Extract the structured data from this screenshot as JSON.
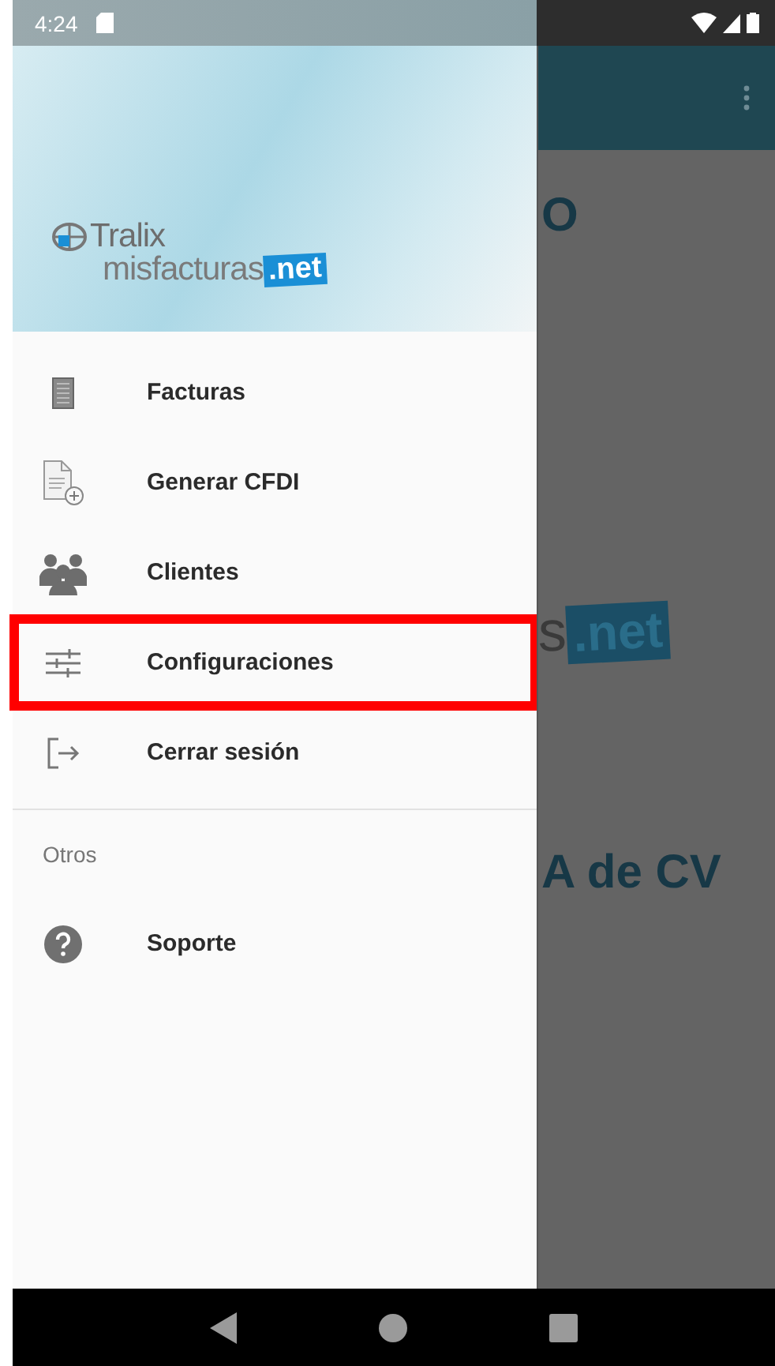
{
  "status_bar": {
    "time": "4:24"
  },
  "drawer": {
    "logo": {
      "brand": "Tralix",
      "product": "misfacturas",
      "badge": ".net"
    },
    "items": [
      {
        "kind": "invoices",
        "label": "Facturas",
        "highlighted": false
      },
      {
        "kind": "generate",
        "label": "Generar CFDI",
        "highlighted": false
      },
      {
        "kind": "clients",
        "label": "Clientes",
        "highlighted": false
      },
      {
        "kind": "settings",
        "label": "Configuraciones",
        "highlighted": true
      },
      {
        "kind": "logout",
        "label": "Cerrar sesión",
        "highlighted": false
      }
    ],
    "section": {
      "title": "Otros",
      "items": [
        {
          "kind": "support",
          "label": "Soporte",
          "highlighted": false
        }
      ]
    }
  },
  "background": {
    "heading": "O",
    "logo_text": "s",
    "logo_badge": ".net",
    "company": "A de CV"
  }
}
